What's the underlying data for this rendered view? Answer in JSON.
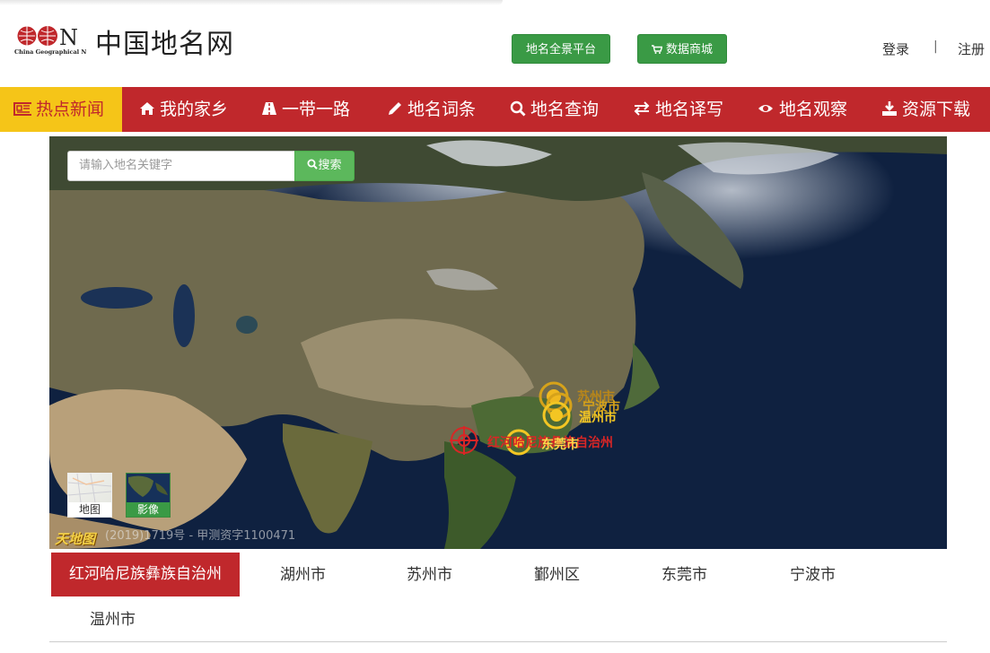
{
  "header": {
    "logo_letters": "CGN",
    "logo_subtitle": "China Geographical Names",
    "site_title": "中国地名网",
    "btn_panorama": "地名全景平台",
    "btn_shop": "数据商城",
    "login": "登录",
    "separator": "|",
    "register": "注册"
  },
  "nav": {
    "items": [
      {
        "label": "热点新闻",
        "icon": "newspaper-icon"
      },
      {
        "label": "我的家乡",
        "icon": "home-icon"
      },
      {
        "label": "一带一路",
        "icon": "road-icon"
      },
      {
        "label": "地名词条",
        "icon": "pencil-icon"
      },
      {
        "label": "地名查询",
        "icon": "search-icon"
      },
      {
        "label": "地名译写",
        "icon": "exchange-icon"
      },
      {
        "label": "地名观察",
        "icon": "eye-icon"
      },
      {
        "label": "资源下载",
        "icon": "download-icon"
      }
    ]
  },
  "map": {
    "search_placeholder": "请输入地名关键字",
    "search_button": "搜索",
    "layer_map": "地图",
    "layer_imagery": "影像",
    "provider_logo": "天地图",
    "copyright": "(2019)1719号 - 甲测资字1100471",
    "markers": [
      {
        "label": "苏州市",
        "color": "#d6a21a"
      },
      {
        "label": "宁波市",
        "color": "#d6a21a"
      },
      {
        "label": "温州市",
        "color": "#f3c623"
      },
      {
        "label": "东莞市",
        "color": "#f3c623"
      },
      {
        "label": "红河哈尼族彝族自治州",
        "color": "#d92626"
      }
    ]
  },
  "tabs": {
    "items": [
      "红河哈尼族彝族自治州",
      "湖州市",
      "苏州市",
      "鄞州区",
      "东莞市",
      "宁波市",
      "温州市"
    ],
    "active_index": 0
  },
  "colors": {
    "brand_red": "#c0282c",
    "active_yellow": "#f5c518",
    "button_green": "#3a9a45",
    "search_green": "#5cb85c"
  }
}
